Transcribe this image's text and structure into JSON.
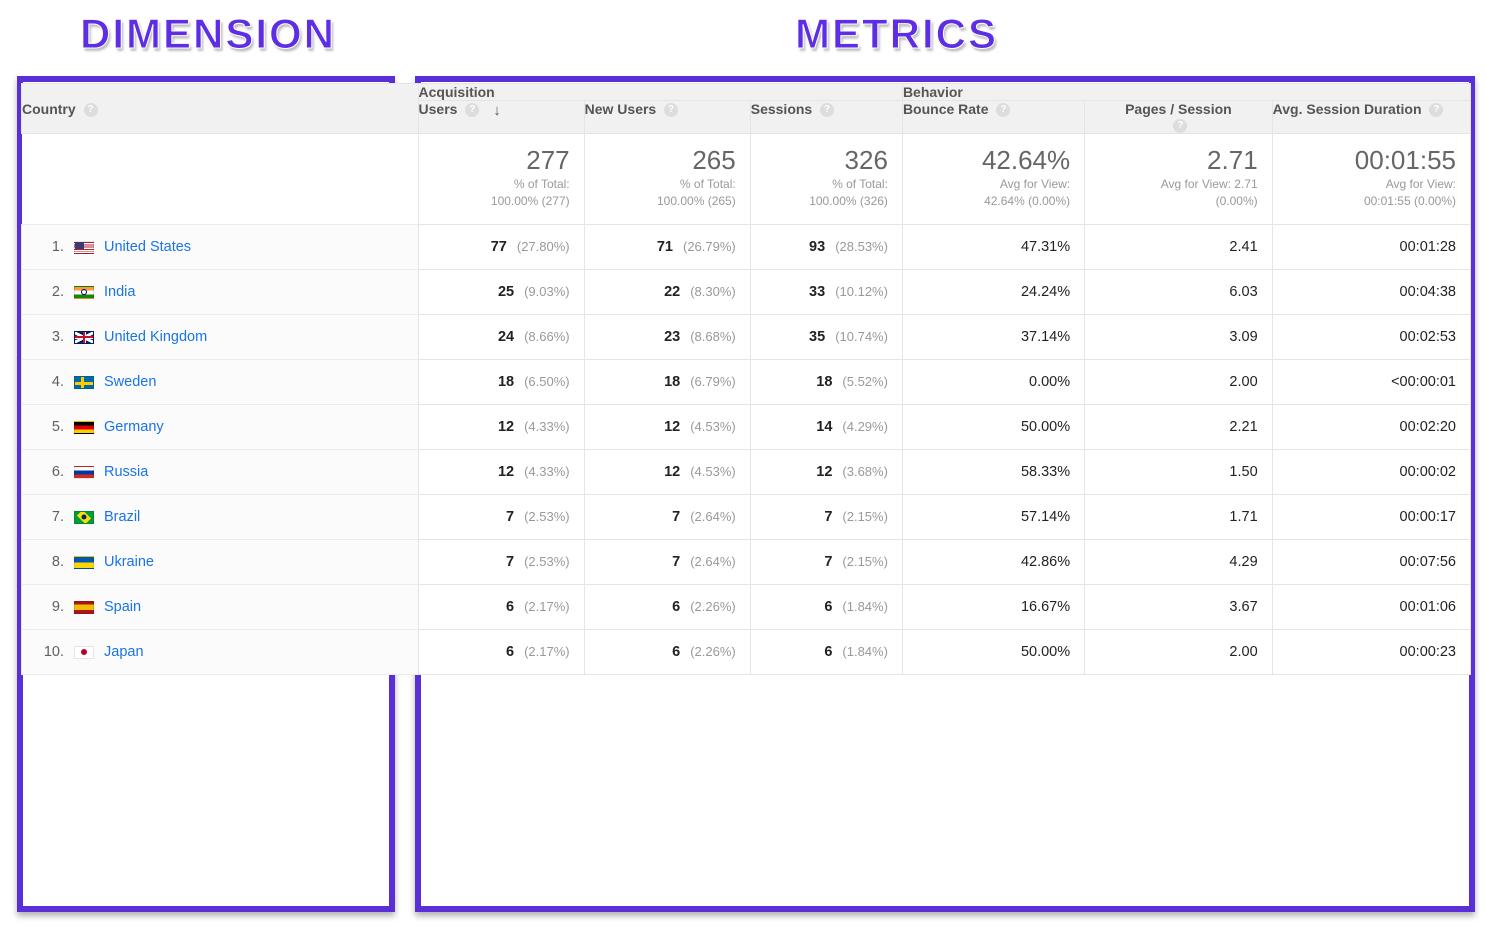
{
  "annotations": {
    "dimension_title": "DIMENSION",
    "metrics_title": "METRICS"
  },
  "headers": {
    "country": "Country",
    "group_acquisition": "Acquisition",
    "group_behavior": "Behavior",
    "users": "Users",
    "new_users": "New Users",
    "sessions": "Sessions",
    "bounce_rate": "Bounce Rate",
    "pages_per_session": "Pages / Session",
    "avg_session_duration": "Avg. Session Duration",
    "help_glyph": "?",
    "sort_glyph": "↓"
  },
  "totals": {
    "users": {
      "value": "277",
      "sub1": "% of Total:",
      "sub2": "100.00% (277)"
    },
    "new_users": {
      "value": "265",
      "sub1": "% of Total:",
      "sub2": "100.00% (265)"
    },
    "sessions": {
      "value": "326",
      "sub1": "% of Total:",
      "sub2": "100.00% (326)"
    },
    "bounce_rate": {
      "value": "42.64%",
      "sub1": "Avg for View:",
      "sub2": "42.64% (0.00%)"
    },
    "pps": {
      "value": "2.71",
      "sub1": "Avg for View: 2.71",
      "sub2": "(0.00%)"
    },
    "avg_duration": {
      "value": "00:01:55",
      "sub1": "Avg for View:",
      "sub2": "00:01:55 (0.00%)"
    }
  },
  "rows": [
    {
      "idx": "1.",
      "flag": "us",
      "country": "United States",
      "users_v": "77",
      "users_p": "(27.80%)",
      "new_v": "71",
      "new_p": "(26.79%)",
      "sess_v": "93",
      "sess_p": "(28.53%)",
      "bounce": "47.31%",
      "pps": "2.41",
      "avg": "00:01:28"
    },
    {
      "idx": "2.",
      "flag": "in",
      "country": "India",
      "users_v": "25",
      "users_p": "(9.03%)",
      "new_v": "22",
      "new_p": "(8.30%)",
      "sess_v": "33",
      "sess_p": "(10.12%)",
      "bounce": "24.24%",
      "pps": "6.03",
      "avg": "00:04:38"
    },
    {
      "idx": "3.",
      "flag": "gb",
      "country": "United Kingdom",
      "users_v": "24",
      "users_p": "(8.66%)",
      "new_v": "23",
      "new_p": "(8.68%)",
      "sess_v": "35",
      "sess_p": "(10.74%)",
      "bounce": "37.14%",
      "pps": "3.09",
      "avg": "00:02:53"
    },
    {
      "idx": "4.",
      "flag": "se",
      "country": "Sweden",
      "users_v": "18",
      "users_p": "(6.50%)",
      "new_v": "18",
      "new_p": "(6.79%)",
      "sess_v": "18",
      "sess_p": "(5.52%)",
      "bounce": "0.00%",
      "pps": "2.00",
      "avg": "<00:00:01"
    },
    {
      "idx": "5.",
      "flag": "de",
      "country": "Germany",
      "users_v": "12",
      "users_p": "(4.33%)",
      "new_v": "12",
      "new_p": "(4.53%)",
      "sess_v": "14",
      "sess_p": "(4.29%)",
      "bounce": "50.00%",
      "pps": "2.21",
      "avg": "00:02:20"
    },
    {
      "idx": "6.",
      "flag": "ru",
      "country": "Russia",
      "users_v": "12",
      "users_p": "(4.33%)",
      "new_v": "12",
      "new_p": "(4.53%)",
      "sess_v": "12",
      "sess_p": "(3.68%)",
      "bounce": "58.33%",
      "pps": "1.50",
      "avg": "00:00:02"
    },
    {
      "idx": "7.",
      "flag": "br",
      "country": "Brazil",
      "users_v": "7",
      "users_p": "(2.53%)",
      "new_v": "7",
      "new_p": "(2.64%)",
      "sess_v": "7",
      "sess_p": "(2.15%)",
      "bounce": "57.14%",
      "pps": "1.71",
      "avg": "00:00:17"
    },
    {
      "idx": "8.",
      "flag": "ua",
      "country": "Ukraine",
      "users_v": "7",
      "users_p": "(2.53%)",
      "new_v": "7",
      "new_p": "(2.64%)",
      "sess_v": "7",
      "sess_p": "(2.15%)",
      "bounce": "42.86%",
      "pps": "4.29",
      "avg": "00:07:56"
    },
    {
      "idx": "9.",
      "flag": "es",
      "country": "Spain",
      "users_v": "6",
      "users_p": "(2.17%)",
      "new_v": "6",
      "new_p": "(2.26%)",
      "sess_v": "6",
      "sess_p": "(1.84%)",
      "bounce": "16.67%",
      "pps": "3.67",
      "avg": "00:01:06"
    },
    {
      "idx": "10.",
      "flag": "jp",
      "country": "Japan",
      "users_v": "6",
      "users_p": "(2.17%)",
      "new_v": "6",
      "new_p": "(2.26%)",
      "sess_v": "6",
      "sess_p": "(1.84%)",
      "bounce": "50.00%",
      "pps": "2.00",
      "avg": "00:00:23"
    }
  ],
  "chart_data": {
    "type": "table",
    "dimension": "Country",
    "metrics": [
      "Users",
      "New Users",
      "Sessions",
      "Bounce Rate",
      "Pages / Session",
      "Avg. Session Duration"
    ],
    "totals": {
      "Users": 277,
      "New Users": 265,
      "Sessions": 326,
      "Bounce Rate": "42.64%",
      "Pages / Session": 2.71,
      "Avg. Session Duration": "00:01:55"
    },
    "rows": [
      {
        "Country": "United States",
        "Users": 77,
        "New Users": 71,
        "Sessions": 93,
        "Bounce Rate": "47.31%",
        "Pages / Session": 2.41,
        "Avg. Session Duration": "00:01:28"
      },
      {
        "Country": "India",
        "Users": 25,
        "New Users": 22,
        "Sessions": 33,
        "Bounce Rate": "24.24%",
        "Pages / Session": 6.03,
        "Avg. Session Duration": "00:04:38"
      },
      {
        "Country": "United Kingdom",
        "Users": 24,
        "New Users": 23,
        "Sessions": 35,
        "Bounce Rate": "37.14%",
        "Pages / Session": 3.09,
        "Avg. Session Duration": "00:02:53"
      },
      {
        "Country": "Sweden",
        "Users": 18,
        "New Users": 18,
        "Sessions": 18,
        "Bounce Rate": "0.00%",
        "Pages / Session": 2.0,
        "Avg. Session Duration": "<00:00:01"
      },
      {
        "Country": "Germany",
        "Users": 12,
        "New Users": 12,
        "Sessions": 14,
        "Bounce Rate": "50.00%",
        "Pages / Session": 2.21,
        "Avg. Session Duration": "00:02:20"
      },
      {
        "Country": "Russia",
        "Users": 12,
        "New Users": 12,
        "Sessions": 12,
        "Bounce Rate": "58.33%",
        "Pages / Session": 1.5,
        "Avg. Session Duration": "00:00:02"
      },
      {
        "Country": "Brazil",
        "Users": 7,
        "New Users": 7,
        "Sessions": 7,
        "Bounce Rate": "57.14%",
        "Pages / Session": 1.71,
        "Avg. Session Duration": "00:00:17"
      },
      {
        "Country": "Ukraine",
        "Users": 7,
        "New Users": 7,
        "Sessions": 7,
        "Bounce Rate": "42.86%",
        "Pages / Session": 4.29,
        "Avg. Session Duration": "00:07:56"
      },
      {
        "Country": "Spain",
        "Users": 6,
        "New Users": 6,
        "Sessions": 6,
        "Bounce Rate": "16.67%",
        "Pages / Session": 3.67,
        "Avg. Session Duration": "00:01:06"
      },
      {
        "Country": "Japan",
        "Users": 6,
        "New Users": 6,
        "Sessions": 6,
        "Bounce Rate": "50.00%",
        "Pages / Session": 2.0,
        "Avg. Session Duration": "00:00:23"
      }
    ]
  }
}
